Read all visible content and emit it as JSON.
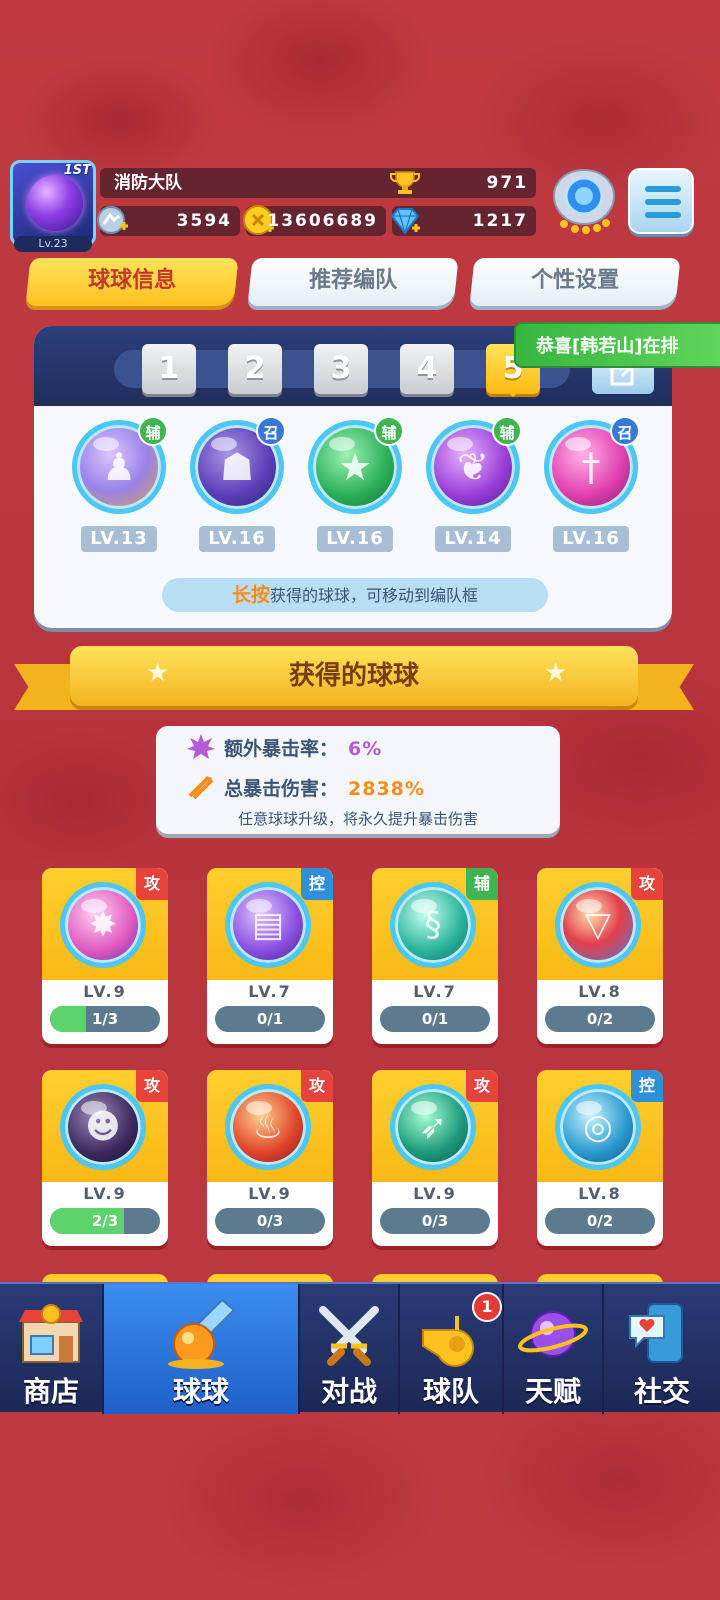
{
  "player": {
    "avatar_rank": "1ST",
    "level": "Lv.23",
    "team_name": "消防大队",
    "trophies": "971",
    "stamina": "3594",
    "gold": "13606689",
    "diamonds": "1217"
  },
  "tabs": [
    {
      "label": "球球信息",
      "active": true
    },
    {
      "label": "推荐编队",
      "active": false
    },
    {
      "label": "个性设置",
      "active": false
    }
  ],
  "lineup": {
    "slots": [
      "1",
      "2",
      "3",
      "4",
      "5"
    ],
    "active_slot": "5",
    "balls": [
      {
        "tag": "辅",
        "level": "LV.13"
      },
      {
        "tag": "召",
        "level": "LV.16"
      },
      {
        "tag": "辅",
        "level": "LV.16"
      },
      {
        "tag": "辅",
        "level": "LV.14"
      },
      {
        "tag": "召",
        "level": "LV.16"
      }
    ],
    "hint_highlight": "长按",
    "hint_text": "获得的球球，可移动到编队框"
  },
  "notice": "恭喜[韩若山]在排",
  "banner_title": "获得的球球",
  "crit": {
    "extra_rate_label": "额外暴击率：",
    "extra_rate_value": "6%",
    "total_damage_label": "总暴击伤害：",
    "total_damage_value": "2838%",
    "note": "任意球球升级，将永久提升暴击伤害",
    "rate_color": "#b85ad8",
    "damage_color": "#ff8c1a"
  },
  "owned_balls": [
    {
      "tag": "攻",
      "level": "LV.9",
      "progress": "1/3",
      "fill": 0.33
    },
    {
      "tag": "控",
      "level": "LV.7",
      "progress": "0/1",
      "fill": 0
    },
    {
      "tag": "辅",
      "level": "LV.7",
      "progress": "0/1",
      "fill": 0
    },
    {
      "tag": "攻",
      "level": "LV.8",
      "progress": "0/2",
      "fill": 0
    },
    {
      "tag": "攻",
      "level": "LV.9",
      "progress": "2/3",
      "fill": 0.67
    },
    {
      "tag": "攻",
      "level": "LV.9",
      "progress": "0/3",
      "fill": 0
    },
    {
      "tag": "攻",
      "level": "LV.9",
      "progress": "0/3",
      "fill": 0
    },
    {
      "tag": "控",
      "level": "LV.8",
      "progress": "0/2",
      "fill": 0
    }
  ],
  "nav": {
    "items": [
      {
        "label": "商店",
        "icon": "shop-icon"
      },
      {
        "label": "球球",
        "icon": "ball-icon",
        "active": true
      },
      {
        "label": "对战",
        "icon": "crossed-swords-icon"
      },
      {
        "label": "球队",
        "icon": "whistle-icon",
        "badge": "1"
      },
      {
        "label": "天赋",
        "icon": "planet-icon"
      },
      {
        "label": "社交",
        "icon": "chat-heart-icon"
      }
    ]
  },
  "colors": {
    "background": "#b8333b",
    "accent_yellow": "#ffc120",
    "tab_active_text": "#c0392b",
    "nav_active": "#3b8df0"
  }
}
